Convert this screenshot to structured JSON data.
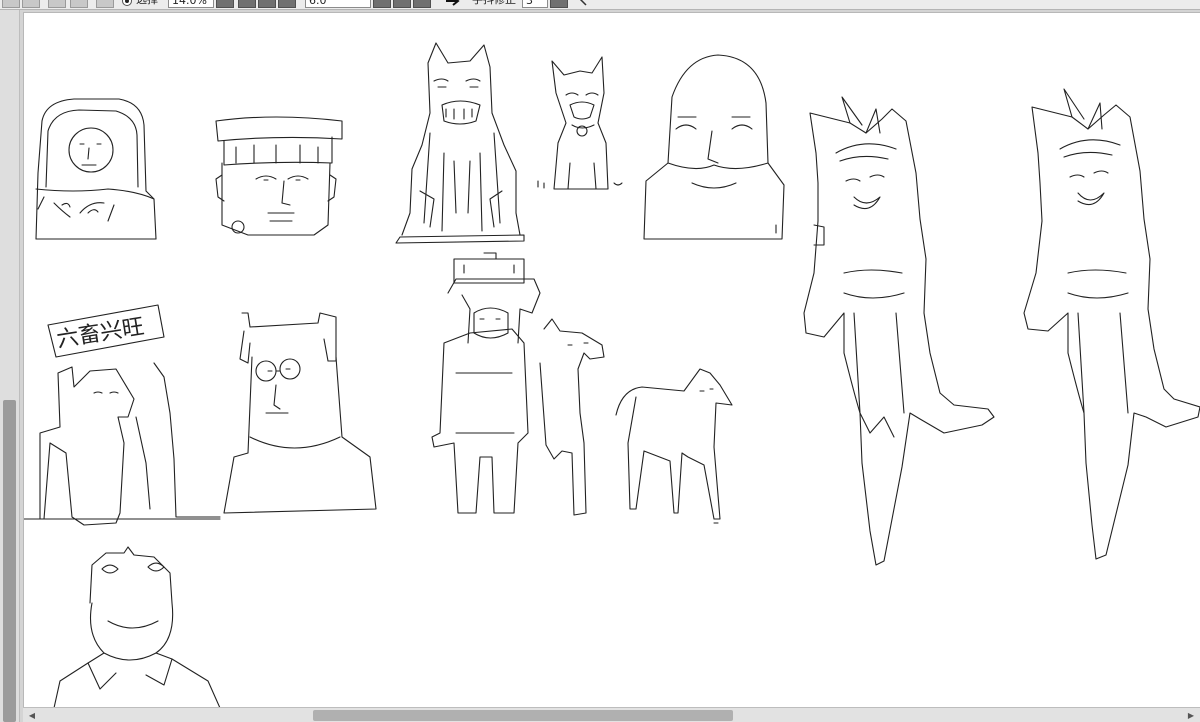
{
  "toolbar": {
    "select_label": "选择",
    "zoom_value": "14.0%",
    "size_value": "6.0",
    "stabilize_label": "手抖修正",
    "stabilize_value": "3"
  },
  "icons": {
    "arrow": "arrow-right-icon",
    "scroll_left": "scroll-left-arrow-icon",
    "scroll_right": "scroll-right-arrow-icon"
  },
  "canvas": {
    "sign_text": "六畜兴旺"
  }
}
